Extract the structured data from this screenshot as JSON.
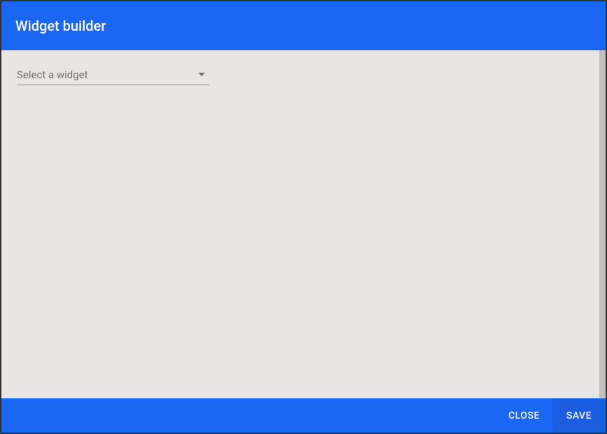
{
  "header": {
    "title": "Widget builder"
  },
  "content": {
    "select": {
      "placeholder": "Select a widget"
    }
  },
  "footer": {
    "close_label": "CLOSE",
    "save_label": "SAVE"
  }
}
